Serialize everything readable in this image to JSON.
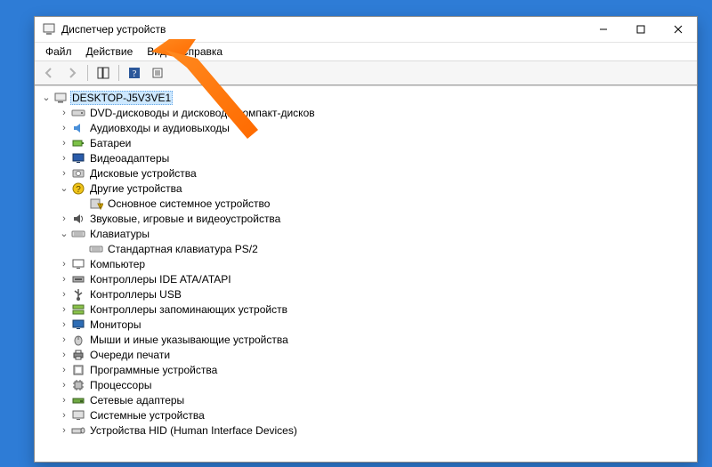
{
  "window": {
    "title": "Диспетчер устройств"
  },
  "menu": {
    "file": "Файл",
    "action": "Действие",
    "view": "Вид",
    "help": "Справка"
  },
  "tree": {
    "root": "DESKTOP-J5V3VE1",
    "dvd": "DVD-дисководы и дисководы компакт-дисков",
    "audio": "Аудиовходы и аудиовыходы",
    "batteries": "Батареи",
    "video": "Видеоадаптеры",
    "disk": "Дисковые устройства",
    "other": "Другие устройства",
    "other_child": "Основное системное устройство",
    "sound": "Звуковые, игровые и видеоустройства",
    "keyboards": "Клавиатуры",
    "keyboards_child": "Стандартная клавиатура PS/2",
    "computer": "Компьютер",
    "ide": "Контроллеры IDE ATA/ATAPI",
    "usb": "Контроллеры USB",
    "storage_ctrl": "Контроллеры запоминающих устройств",
    "monitors": "Мониторы",
    "mice": "Мыши и иные указывающие устройства",
    "print_queues": "Очереди печати",
    "software": "Программные устройства",
    "processors": "Процессоры",
    "network": "Сетевые адаптеры",
    "system": "Системные устройства",
    "hid": "Устройства HID (Human Interface Devices)"
  }
}
